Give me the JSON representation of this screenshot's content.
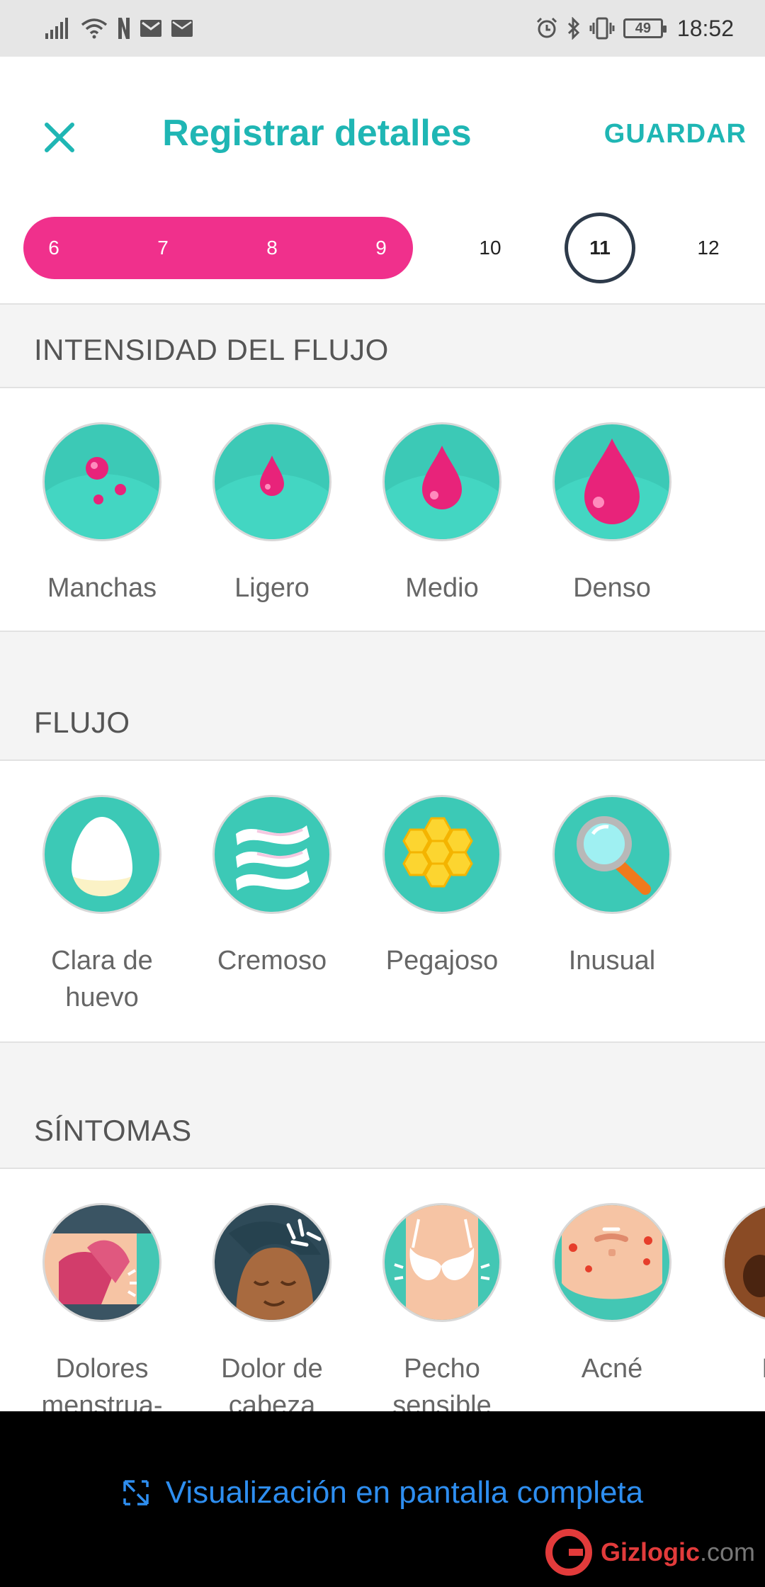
{
  "status_bar": {
    "time": "18:52",
    "battery": "49",
    "left_icons": [
      "signal-icon",
      "wifi-icon",
      "netflix-icon",
      "gmail-icon",
      "mail-icon"
    ],
    "right_icons": [
      "alarm-icon",
      "bluetooth-icon",
      "vibrate-icon",
      "battery-icon"
    ]
  },
  "header": {
    "title": "Registrar detalles",
    "save_label": "GUARDAR",
    "close_icon": "close-icon"
  },
  "dates": {
    "days": [
      "6",
      "7",
      "8",
      "9",
      "10",
      "11",
      "12"
    ],
    "period_days": [
      "6",
      "7",
      "8",
      "9"
    ],
    "selected": "11"
  },
  "sections": {
    "intensity": {
      "title": "INTENSIDAD DEL FLUJO",
      "options": [
        {
          "label": "Manchas",
          "icon": "spots-icon"
        },
        {
          "label": "Ligero",
          "icon": "small-drop-icon"
        },
        {
          "label": "Medio",
          "icon": "medium-drop-icon"
        },
        {
          "label": "Denso",
          "icon": "large-drop-icon"
        }
      ]
    },
    "flow": {
      "title": "FLUJO",
      "options": [
        {
          "label": "Clara de huevo",
          "icon": "egg-icon"
        },
        {
          "label": "Cremoso",
          "icon": "waves-icon"
        },
        {
          "label": "Pegajoso",
          "icon": "honeycomb-icon"
        },
        {
          "label": "Inusual",
          "icon": "magnifier-icon"
        }
      ]
    },
    "symptoms": {
      "title": "SÍNTOMAS",
      "options": [
        {
          "label": "Dolores menstrua-",
          "icon": "cramps-icon"
        },
        {
          "label": "Dolor de cabeza",
          "icon": "headache-icon"
        },
        {
          "label": "Pecho sensible",
          "icon": "breast-icon"
        },
        {
          "label": "Acné",
          "icon": "acne-icon"
        },
        {
          "label": "Enf",
          "icon": "partial-icon"
        }
      ]
    }
  },
  "bottom": {
    "fullscreen_label": "Visualización en pantalla completa",
    "watermark_brand": "Gizlogic",
    "watermark_tld": ".com"
  },
  "colors": {
    "accent": "#1fb6b4",
    "period": "#f0308c",
    "icon_bg": "#3cc9b6",
    "link": "#2e8ef0"
  }
}
